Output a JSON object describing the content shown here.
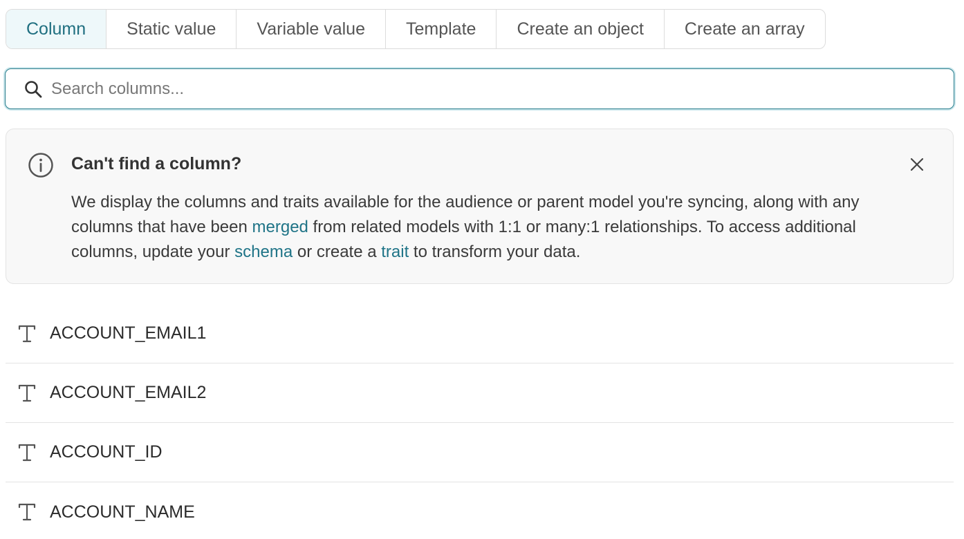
{
  "tabs": [
    {
      "label": "Column",
      "active": true
    },
    {
      "label": "Static value",
      "active": false
    },
    {
      "label": "Variable value",
      "active": false
    },
    {
      "label": "Template",
      "active": false
    },
    {
      "label": "Create an object",
      "active": false
    },
    {
      "label": "Create an array",
      "active": false
    }
  ],
  "search": {
    "placeholder": "Search columns...",
    "value": "",
    "icon": "search-icon"
  },
  "notice": {
    "icon": "info-icon",
    "title": "Can't find a column?",
    "body": {
      "p1": "We display the columns and traits available for the audience or parent model you're syncing, along with any columns that have been ",
      "link1": "merged",
      "p2": " from related models with 1:1 or many:1 relationships. To access additional columns, update your ",
      "link2": "schema",
      "p3": " or create a ",
      "link3": "trait",
      "p4": " to transform your data."
    },
    "close_icon": "close-icon"
  },
  "columns": [
    {
      "name": "ACCOUNT_EMAIL1",
      "type_icon": "text-type-icon"
    },
    {
      "name": "ACCOUNT_EMAIL2",
      "type_icon": "text-type-icon"
    },
    {
      "name": "ACCOUNT_ID",
      "type_icon": "text-type-icon"
    },
    {
      "name": "ACCOUNT_NAME",
      "type_icon": "text-type-icon"
    }
  ],
  "colors": {
    "accent": "#1f7487",
    "active_tab_bg": "#eef8fa",
    "notice_bg": "#f8f8f8"
  }
}
